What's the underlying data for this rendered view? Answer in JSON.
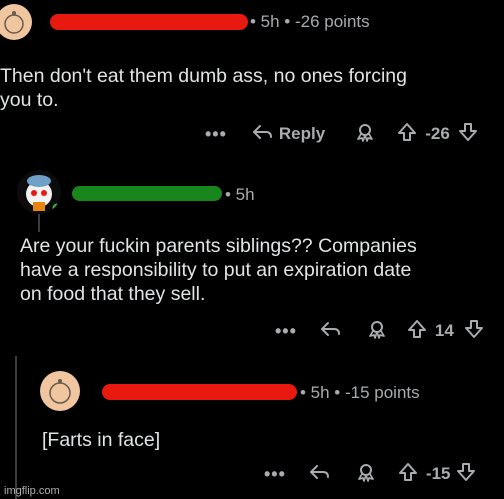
{
  "comments": [
    {
      "meta": "• 5h • -26 points",
      "text_line1": "Then don't eat them dumb ass, no ones forcing",
      "text_line2": "you to.",
      "actions": {
        "dots": "•••",
        "reply": "Reply",
        "score": "-26"
      }
    },
    {
      "meta": "• 5h",
      "text_line1": "Are your fuckin parents siblings?? Companies",
      "text_line2": "have a responsibility to put an expiration date",
      "text_line3": "on food that they sell.",
      "actions": {
        "dots": "•••",
        "score": "14"
      }
    },
    {
      "meta": "• 5h • -15 points",
      "text_line1": "[Farts in face]",
      "actions": {
        "dots": "•••",
        "score": "-15"
      }
    }
  ],
  "watermark": "imgflip.com",
  "colors": {
    "background": "#000000",
    "redact_red": "#e8190f",
    "redact_green": "#18861c",
    "avatar": "#efc6a0"
  },
  "icons": [
    "reply-arrow-icon",
    "award-icon",
    "upvote-arrow-icon",
    "downvote-arrow-icon",
    "more-dots-icon",
    "avatar-icon"
  ]
}
